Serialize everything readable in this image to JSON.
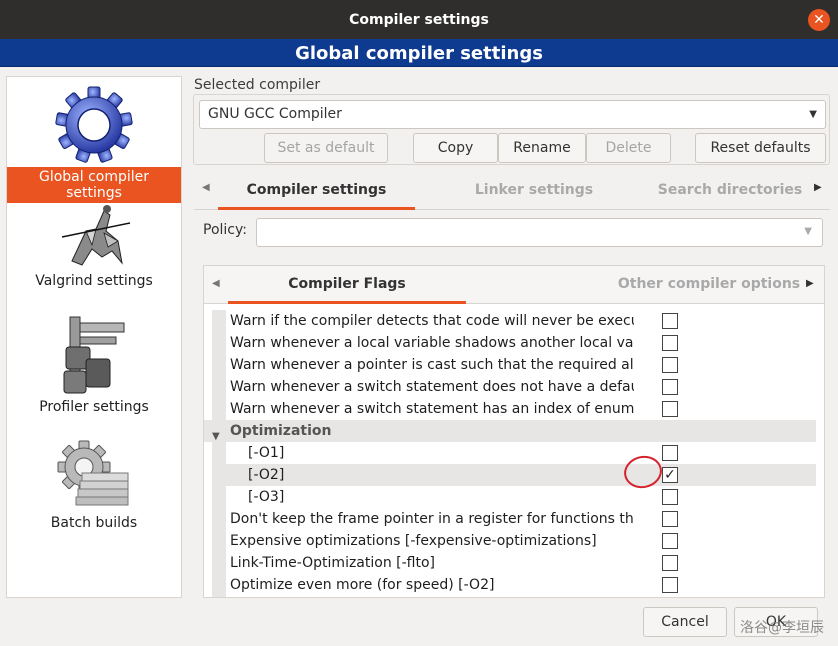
{
  "window": {
    "title": "Compiler settings",
    "close_label": "✕"
  },
  "banner": {
    "title": "Global compiler settings"
  },
  "sidebar": {
    "items": [
      {
        "label": "Global compiler settings",
        "icon": "gear-icon",
        "selected": true
      },
      {
        "label": "Valgrind settings",
        "icon": "knight-icon",
        "selected": false
      },
      {
        "label": "Profiler settings",
        "icon": "caliper-icon",
        "selected": false
      },
      {
        "label": "Batch builds",
        "icon": "gear-stack-icon",
        "selected": false
      }
    ]
  },
  "compiler_group": {
    "label": "Selected compiler",
    "selected_compiler": "GNU GCC Compiler",
    "buttons": {
      "set_default": "Set as default",
      "copy": "Copy",
      "rename": "Rename",
      "delete": "Delete",
      "reset": "Reset defaults"
    }
  },
  "outer_tabs": {
    "items": [
      "Compiler settings",
      "Linker settings",
      "Search directories"
    ],
    "active": "Compiler settings"
  },
  "policy": {
    "label": "Policy:",
    "value": ""
  },
  "inner_tabs": {
    "items": [
      "Compiler Flags",
      "Other compiler options"
    ],
    "active": "Compiler Flags"
  },
  "flags": {
    "rows": [
      {
        "text": "Warn if the compiler detects that code will never be executec",
        "checked": false
      },
      {
        "text": "Warn whenever a local variable shadows another local variab",
        "checked": false
      },
      {
        "text": "Warn whenever a pointer is cast such that the required alignn",
        "checked": false
      },
      {
        "text": "Warn whenever a switch statement does not have a default ca",
        "checked": false
      },
      {
        "text": "Warn whenever a switch statement has an index of enumerat",
        "checked": false
      }
    ],
    "category": "Optimization",
    "opt_rows": [
      {
        "text": "[-O1]",
        "checked": false
      },
      {
        "text": "[-O2]",
        "checked": true
      },
      {
        "text": "[-O3]",
        "checked": false
      }
    ],
    "more_rows": [
      {
        "text": "Don't keep the frame pointer in a register for functions that c",
        "checked": false
      },
      {
        "text": "Expensive optimizations  [-fexpensive-optimizations]",
        "checked": false
      },
      {
        "text": "Link-Time-Optimization  [-flto]",
        "checked": false
      },
      {
        "text": "Optimize even more (for speed)  [-O2]",
        "checked": false
      }
    ],
    "check_mark": "✓"
  },
  "footer": {
    "cancel": "Cancel",
    "ok": "OK"
  },
  "watermark": "洛谷@李垣辰",
  "colors": {
    "accent": "#e95420",
    "banner": "#0e3a8f",
    "titlebar": "#2f2e2c"
  }
}
